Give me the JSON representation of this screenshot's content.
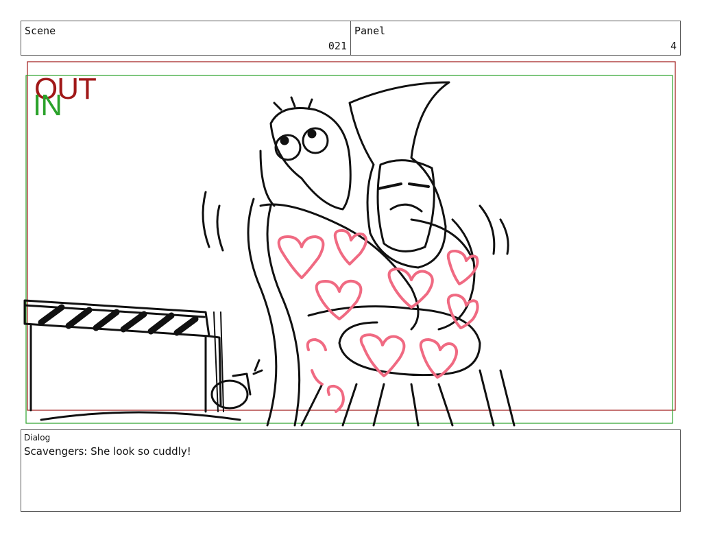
{
  "header": {
    "scene_label": "Scene",
    "scene_value": "021",
    "panel_label": "Panel",
    "panel_value": "4"
  },
  "frame_markers": {
    "out_label": "OUT",
    "in_label": "IN",
    "out_color": "#a01818",
    "in_color": "#2aa22a"
  },
  "dialog": {
    "label": "Dialog",
    "text": "Scavengers: She look so cuddly!"
  },
  "colors": {
    "heart_pink": "#f06a82",
    "ink": "#111111"
  }
}
